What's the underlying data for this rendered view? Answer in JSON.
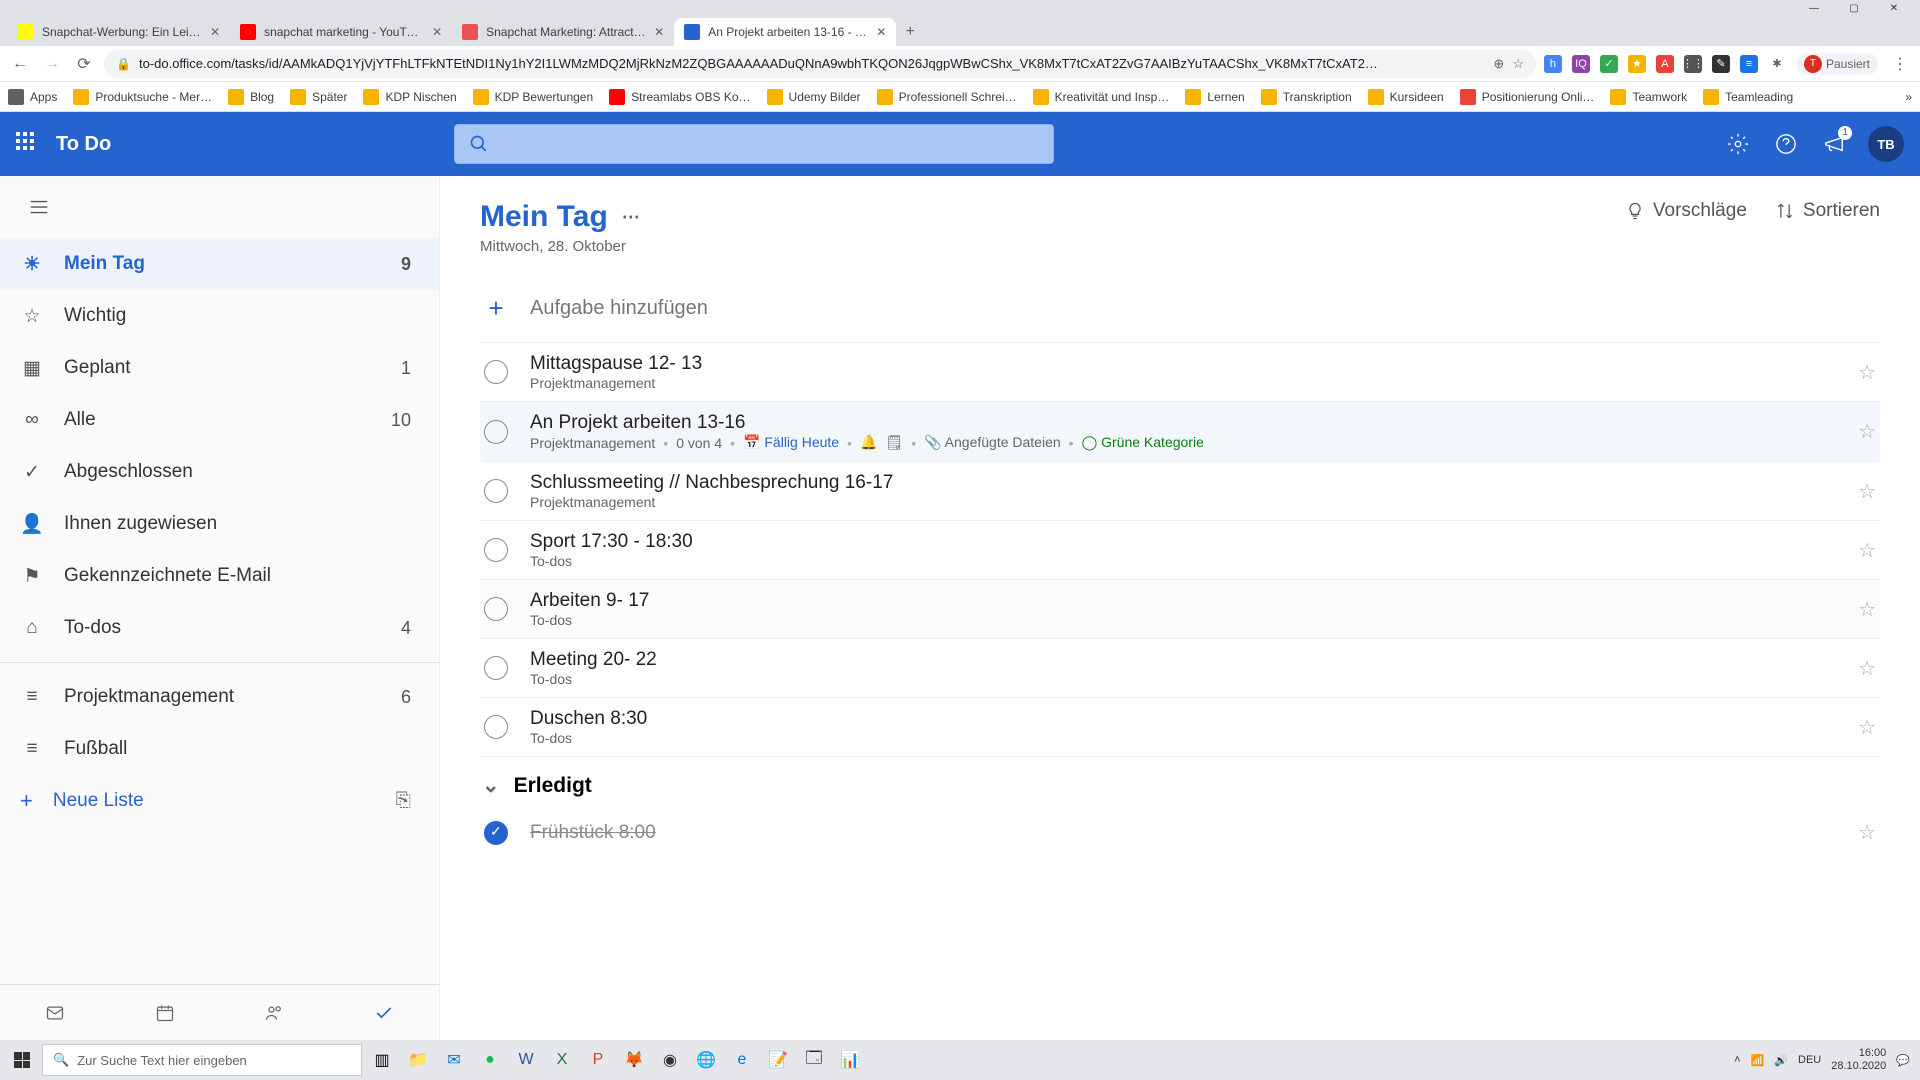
{
  "browser": {
    "tabs": [
      {
        "title": "Snapchat-Werbung: Ein Leitfad…",
        "favcolor": "#fffc00"
      },
      {
        "title": "snapchat marketing - YouTube",
        "favcolor": "#ff0000"
      },
      {
        "title": "Snapchat Marketing: Attract New…",
        "favcolor": "#ec5252"
      },
      {
        "title": "An Projekt arbeiten 13-16 - To D…",
        "favcolor": "#2564cf"
      }
    ],
    "url": "to-do.office.com/tasks/id/AAMkADQ1YjVjYTFhLTFkNTEtNDI1Ny1hY2I1LWMzMDQ2MjRkNzM2ZQBGAAAAAADuQNnA9wbhTKQON26JqgpWBwCShx_VK8MxT7tCxAT2ZvG7AAIBzYuTAACShx_VK8MxT7tCxAT2…",
    "profile_label": "Pausiert",
    "profile_initial": "T",
    "bookmarks": [
      "Apps",
      "Produktsuche - Mer…",
      "Blog",
      "Später",
      "KDP Nischen",
      "KDP Bewertungen",
      "Streamlabs OBS Ko…",
      "Udemy Bilder",
      "Professionell Schrei…",
      "Kreativität und Insp…",
      "Lernen",
      "Transkription",
      "Kursideen",
      "Positionierung Onli…",
      "Teamwork",
      "Teamleading"
    ]
  },
  "header": {
    "app_name": "To Do",
    "notif_count": "1",
    "avatar": "TB"
  },
  "sidebar": {
    "items": [
      {
        "label": "Mein Tag",
        "count": "9"
      },
      {
        "label": "Wichtig",
        "count": ""
      },
      {
        "label": "Geplant",
        "count": "1"
      },
      {
        "label": "Alle",
        "count": "10"
      },
      {
        "label": "Abgeschlossen",
        "count": ""
      },
      {
        "label": "Ihnen zugewiesen",
        "count": ""
      },
      {
        "label": "Gekennzeichnete E-Mail",
        "count": ""
      },
      {
        "label": "To-dos",
        "count": "4"
      }
    ],
    "lists": [
      {
        "label": "Projektmanagement",
        "count": "6"
      },
      {
        "label": "Fußball",
        "count": ""
      }
    ],
    "new_list": "Neue Liste"
  },
  "main": {
    "title": "Mein Tag",
    "date": "Mittwoch, 28. Oktober",
    "suggestions": "Vorschläge",
    "sort": "Sortieren",
    "add_placeholder": "Aufgabe hinzufügen",
    "done_header": "Erledigt",
    "tasks": [
      {
        "title": "Mittagspause 12- 13",
        "meta": "Projektmanagement"
      },
      {
        "title": "An Projekt arbeiten 13-16",
        "meta": "Projektmanagement",
        "steps": "0 von 4",
        "due": "Fällig Heute",
        "attach": "Angefügte Dateien",
        "category": "Grüne Kategorie",
        "selected": true
      },
      {
        "title": "Schlussmeeting // Nachbesprechung 16-17",
        "meta": "Projektmanagement"
      },
      {
        "title": "Sport 17:30 - 18:30",
        "meta": "To-dos"
      },
      {
        "title": "Arbeiten 9- 17",
        "meta": "To-dos"
      },
      {
        "title": "Meeting 20- 22",
        "meta": "To-dos"
      },
      {
        "title": "Duschen 8:30",
        "meta": "To-dos"
      }
    ],
    "completed": [
      {
        "title": "Frühstück 8:00"
      }
    ]
  },
  "taskbar": {
    "search_placeholder": "Zur Suche Text hier eingeben",
    "lang": "DEU",
    "time": "16:00",
    "date": "28.10.2020"
  }
}
